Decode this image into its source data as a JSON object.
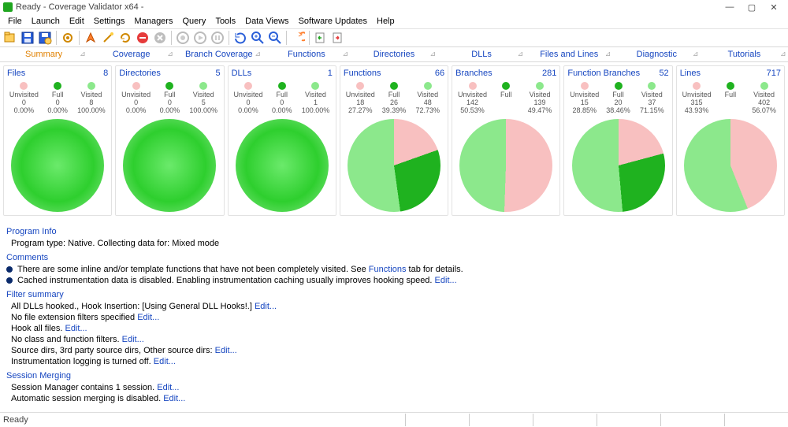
{
  "window": {
    "title": "Ready - Coverage Validator x64 -"
  },
  "menu": [
    "File",
    "Launch",
    "Edit",
    "Settings",
    "Managers",
    "Query",
    "Tools",
    "Data Views",
    "Software Updates",
    "Help"
  ],
  "tabs": [
    "Summary",
    "Coverage",
    "Branch Coverage",
    "Functions",
    "Directories",
    "DLLs",
    "Files and Lines",
    "Diagnostic",
    "Tutorials"
  ],
  "active_tab": 0,
  "legend_labels": {
    "un": "Unvisited",
    "full": "Full",
    "vis": "Visited"
  },
  "chart_data": [
    {
      "title": "Files",
      "total": 8,
      "type": "pie",
      "series": [
        {
          "name": "Unvisited",
          "value": 0,
          "pct": "0.00%",
          "color": "#f8c0c0"
        },
        {
          "name": "Full",
          "value": 0,
          "pct": "0.00%",
          "color": "#1fb21f"
        },
        {
          "name": "Visited",
          "value": 8,
          "pct": "100.00%",
          "color": "#8ce88c"
        }
      ]
    },
    {
      "title": "Directories",
      "total": 5,
      "type": "pie",
      "series": [
        {
          "name": "Unvisited",
          "value": 0,
          "pct": "0.00%",
          "color": "#f8c0c0"
        },
        {
          "name": "Full",
          "value": 0,
          "pct": "0.00%",
          "color": "#1fb21f"
        },
        {
          "name": "Visited",
          "value": 5,
          "pct": "100.00%",
          "color": "#8ce88c"
        }
      ]
    },
    {
      "title": "DLLs",
      "total": 1,
      "type": "pie",
      "series": [
        {
          "name": "Unvisited",
          "value": 0,
          "pct": "0.00%",
          "color": "#f8c0c0"
        },
        {
          "name": "Full",
          "value": 0,
          "pct": "0.00%",
          "color": "#1fb21f"
        },
        {
          "name": "Visited",
          "value": 1,
          "pct": "100.00%",
          "color": "#8ce88c"
        }
      ]
    },
    {
      "title": "Functions",
      "total": 66,
      "type": "pie",
      "series": [
        {
          "name": "Unvisited",
          "value": 18,
          "pct": "27.27%",
          "color": "#f8c0c0"
        },
        {
          "name": "Full",
          "value": 26,
          "pct": "39.39%",
          "color": "#1fb21f"
        },
        {
          "name": "Visited",
          "value": 48,
          "pct": "72.73%",
          "color": "#8ce88c"
        }
      ]
    },
    {
      "title": "Branches",
      "total": 281,
      "type": "pie",
      "series": [
        {
          "name": "Unvisited",
          "value": 142,
          "pct": "50.53%",
          "color": "#f8c0c0"
        },
        {
          "name": "Full",
          "value": "",
          "pct": "",
          "color": "#1fb21f"
        },
        {
          "name": "Visited",
          "value": 139,
          "pct": "49.47%",
          "color": "#8ce88c"
        }
      ]
    },
    {
      "title": "Function Branches",
      "total": 52,
      "type": "pie",
      "series": [
        {
          "name": "Unvisited",
          "value": 15,
          "pct": "28.85%",
          "color": "#f8c0c0"
        },
        {
          "name": "Full",
          "value": 20,
          "pct": "38.46%",
          "color": "#1fb21f"
        },
        {
          "name": "Visited",
          "value": 37,
          "pct": "71.15%",
          "color": "#8ce88c"
        }
      ]
    },
    {
      "title": "Lines",
      "total": 717,
      "type": "pie",
      "series": [
        {
          "name": "Unvisited",
          "value": 315,
          "pct": "43.93%",
          "color": "#f8c0c0"
        },
        {
          "name": "Full",
          "value": "",
          "pct": "",
          "color": "#1fb21f"
        },
        {
          "name": "Visited",
          "value": 402,
          "pct": "56.07%",
          "color": "#8ce88c"
        }
      ]
    }
  ],
  "info": {
    "program_info_h": "Program Info",
    "program_info_line": "Program type: Native. Collecting data for: Mixed mode",
    "comments_h": "Comments",
    "comment1_pre": "There are some inline and/or template functions that have not been completely visited. See ",
    "comment1_link": "Functions",
    "comment1_post": " tab for details.",
    "comment2_pre": "Cached instrumentation data is disabled. Enabling instrumentation caching usually improves hooking speed. ",
    "edit": "Edit...",
    "filter_h": "Filter summary",
    "filter_lines": [
      "All DLLs hooked., Hook Insertion: [Using General DLL Hooks!.] ",
      "No file extension filters specified ",
      "Hook all files. ",
      "No class and function filters. ",
      "Source dirs, 3rd party source dirs, Other source dirs: ",
      "Instrumentation logging is turned off. "
    ],
    "session_h": "Session Merging",
    "session_line1": "Session Manager contains 1 session. ",
    "session_line2": "Automatic session merging is disabled. "
  },
  "status": {
    "text": "Ready"
  }
}
